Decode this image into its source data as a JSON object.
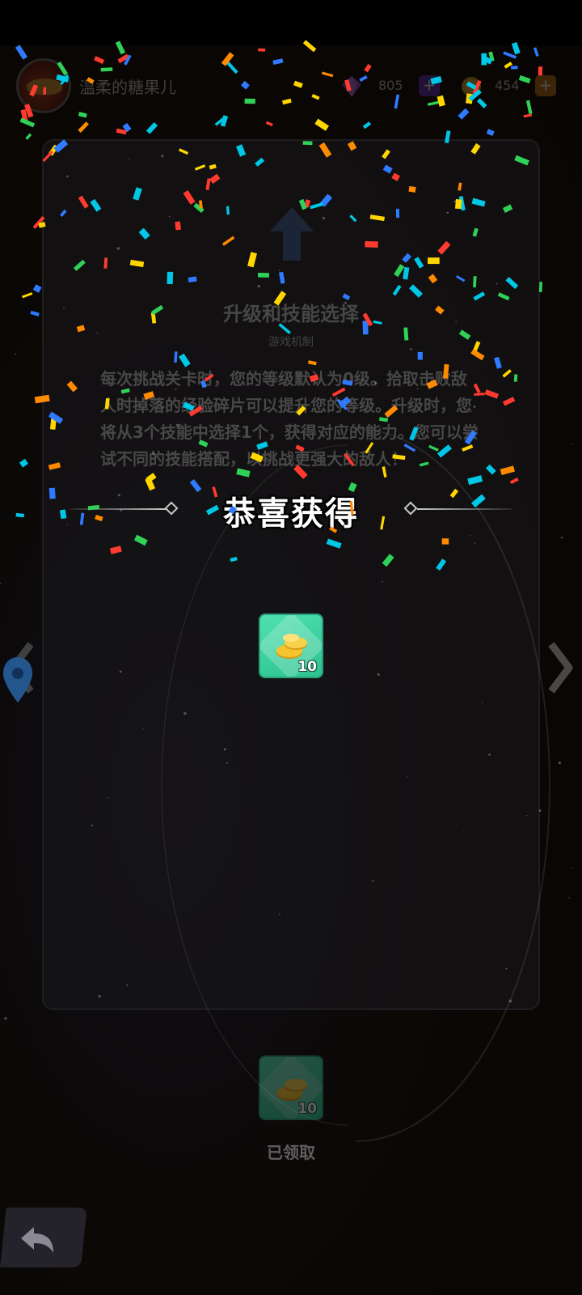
{
  "header": {
    "username": "温柔的糖果儿",
    "gems": "805",
    "coins": "454",
    "gem_icon": "purple-crystal-icon",
    "coin_icon": "gold-coin-icon"
  },
  "panel": {
    "title": "升级和技能选择",
    "subtitle": "游戏机制",
    "description": "每次挑战关卡时，您的等级默认为0级。拾取击败敌人时掉落的经验碎片可以提升您的等级。升级时，您将从3个技能中选择1个，获得对应的能力。您可以尝试不同的技能搭配，以挑战更强大的敌人！"
  },
  "congrats": {
    "title": "恭喜获得",
    "reward": {
      "icon": "gold-coins-icon",
      "quantity": "10"
    }
  },
  "claimed": {
    "reward": {
      "icon": "gold-coins-icon",
      "quantity": "10"
    },
    "label": "已领取"
  },
  "colors": {
    "reward_bg": "#3fd4a2",
    "background": "#120d0a",
    "confetti": [
      "#ff3b30",
      "#ff8a00",
      "#ffd600",
      "#30d158",
      "#00c7e6",
      "#2f7bff",
      "#ffffff"
    ]
  }
}
